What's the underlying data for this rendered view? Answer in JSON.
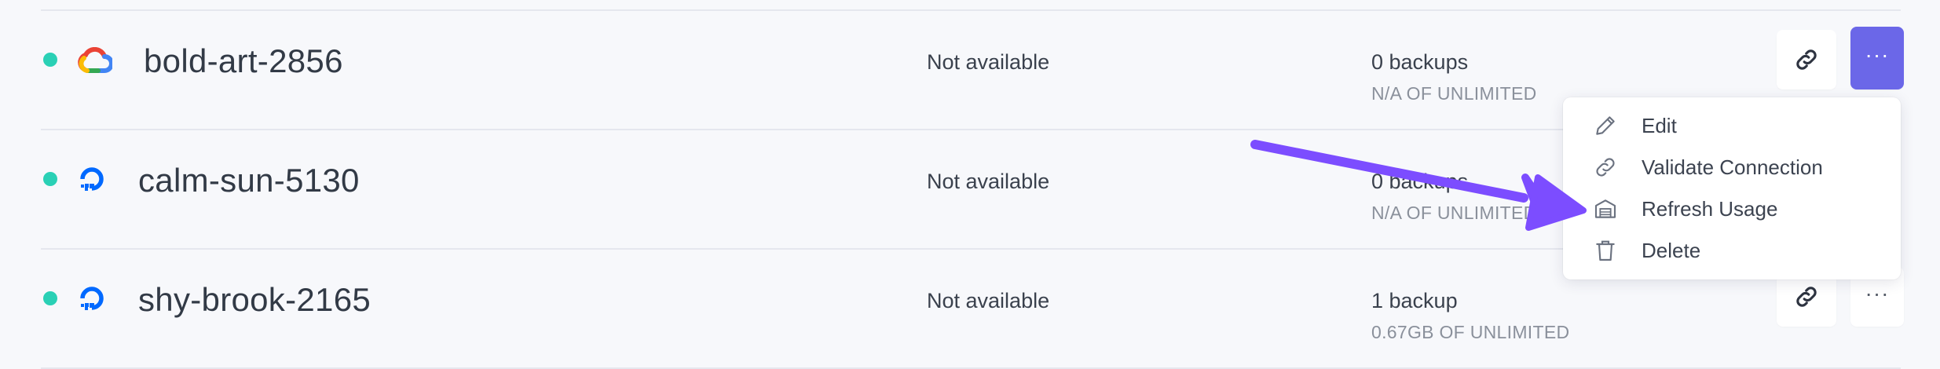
{
  "servers": [
    {
      "name": "bold-art-2856",
      "availability": "Not available",
      "backups": "0 backups",
      "usage": "N/A OF UNLIMITED",
      "provider_icon": "google-cloud-icon"
    },
    {
      "name": "calm-sun-5130",
      "availability": "Not available",
      "backups": "0 backups",
      "usage": "N/A OF UNLIMITED",
      "provider_icon": "digitalocean-icon"
    },
    {
      "name": "shy-brook-2165",
      "availability": "Not available",
      "backups": "1 backup",
      "usage": "0.67GB OF UNLIMITED",
      "provider_icon": "digitalocean-icon"
    }
  ],
  "actions": {
    "link_icon": "link-icon",
    "more_label": "···"
  },
  "dropdown": {
    "items": [
      {
        "label": "Edit",
        "icon": "pencil-icon"
      },
      {
        "label": "Validate Connection",
        "icon": "link-icon"
      },
      {
        "label": "Refresh Usage",
        "icon": "storage-icon"
      },
      {
        "label": "Delete",
        "icon": "trash-icon"
      }
    ]
  },
  "colors": {
    "status_online": "#2ad0b5",
    "accent": "#6b67e8",
    "annotation_arrow": "#7c4dff",
    "digitalocean": "#0069ff"
  }
}
